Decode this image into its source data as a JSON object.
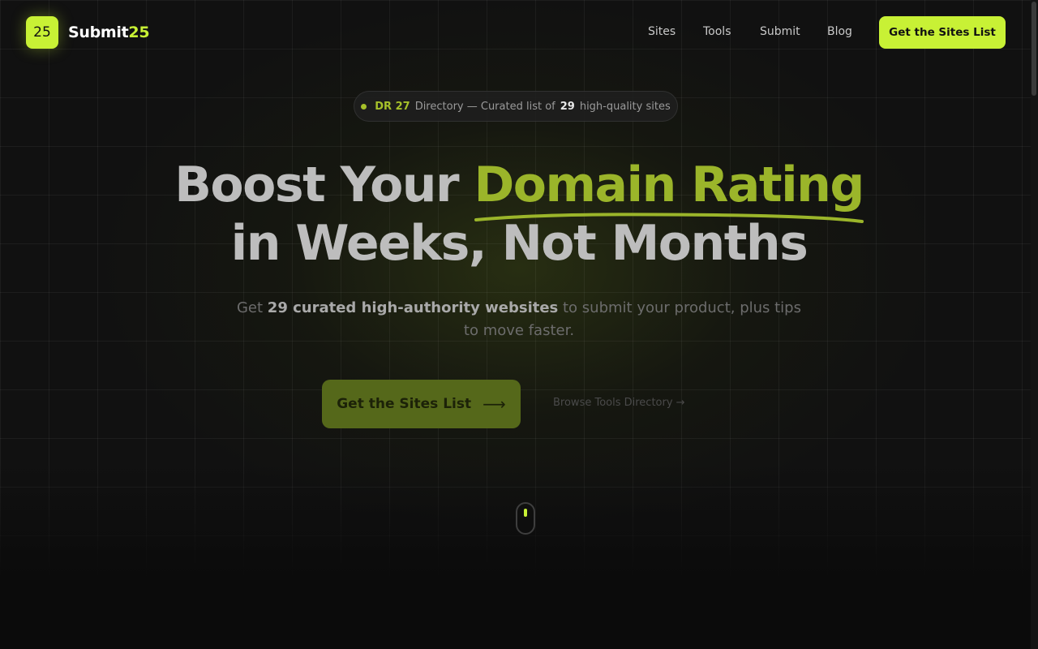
{
  "header": {
    "logo_badge": "25",
    "logo_name": "Submit",
    "logo_accent": "25",
    "nav": {
      "sites": "Sites",
      "tools": "Tools",
      "submit": "Submit",
      "blog": "Blog"
    },
    "cta_label": "Get the Sites List"
  },
  "pill": {
    "dr": "DR 27",
    "directory": "Directory — Curated list of",
    "count": "29",
    "suffix": "high-quality sites"
  },
  "headline": {
    "line1_plain": "Boost Your ",
    "line1_highlight": "Domain Rating",
    "line2": "in Weeks, Not Months"
  },
  "subheadline": {
    "prefix": "Get ",
    "strong": "29 curated high-authority websites",
    "suffix": " to submit your product, plus tips to move faster."
  },
  "cta": {
    "primary_label": "Get the Sites List",
    "primary_arrow": "⟶",
    "secondary_label": "Browse Tools Directory →"
  },
  "colors": {
    "accent": "#c8f135",
    "background": "#0b0b0b"
  },
  "icons": {
    "scroll_indicator": "mouse-scroll-icon",
    "pill_dot": "status-dot-icon"
  }
}
